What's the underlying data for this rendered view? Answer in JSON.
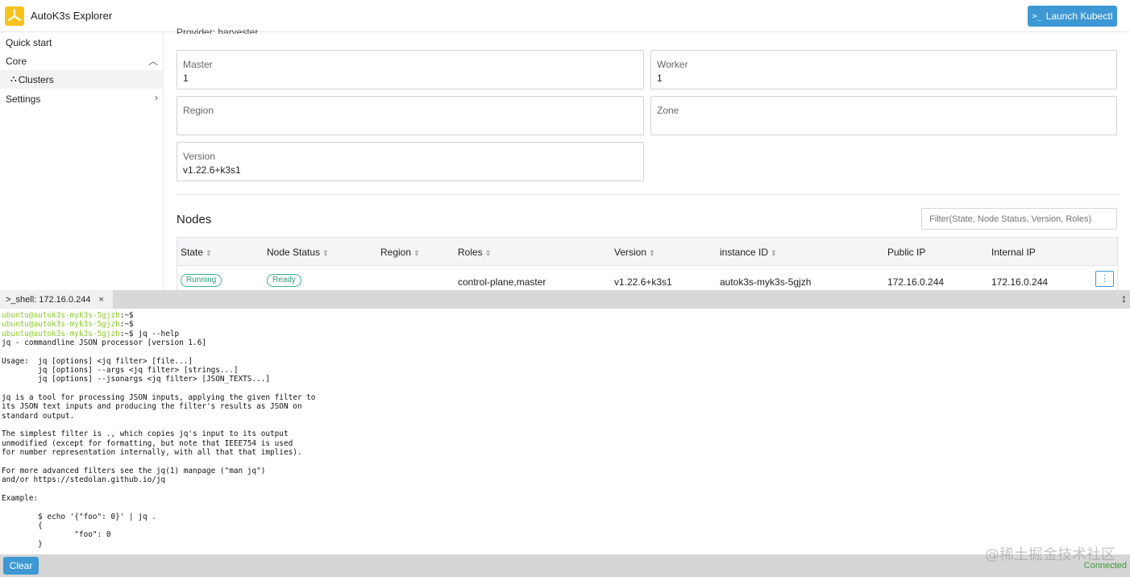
{
  "header": {
    "app_title": "AutoK3s Explorer",
    "launch_label": "Launch Kubectl",
    "launch_prompt": ">_"
  },
  "sidebar": {
    "items": [
      {
        "label": "Quick start"
      },
      {
        "label": "Core",
        "chevron": "^"
      },
      {
        "label": "Clusters",
        "icon": "cluster-icon"
      },
      {
        "label": "Settings",
        "chevron": ">"
      }
    ]
  },
  "detail": {
    "provider_partial": "Provider: harvester",
    "fields": {
      "master": {
        "label": "Master",
        "value": "1"
      },
      "worker": {
        "label": "Worker",
        "value": "1"
      },
      "region": {
        "label": "Region",
        "value": ""
      },
      "zone": {
        "label": "Zone",
        "value": ""
      },
      "version": {
        "label": "Version",
        "value": "v1.22.6+k3s1"
      }
    }
  },
  "nodes": {
    "title": "Nodes",
    "filter_placeholder": "Filter(State, Node Status, Version, Roles)",
    "columns": [
      "State",
      "Node Status",
      "Region",
      "Roles",
      "Version",
      "instance ID",
      "Public IP",
      "Internal IP"
    ],
    "sort_glyph": "⇕",
    "rows": [
      {
        "state": "Running",
        "node_status": "Ready",
        "region": "",
        "roles": "control-plane,master",
        "version": "v1.22.6+k3s1",
        "instance_id": "autok3s-myk3s-5gjzh",
        "public_ip": "172.16.0.244",
        "internal_ip": "172.16.0.244",
        "actions": "⋮"
      }
    ]
  },
  "terminal": {
    "tab_label": ">_shell: 172.16.0.244",
    "tab_close": "×",
    "resize": "↕",
    "prompt_user": "ubuntu@autok3s-myk3s-5gjzh",
    "prompt_suffix": ":~$",
    "command": " jq --help",
    "output": "jq - commandline JSON processor [version 1.6]\n\nUsage:  jq [options] <jq filter> [file...]\n        jq [options] --args <jq filter> [strings...]\n        jq [options] --jsonargs <jq filter> [JSON_TEXTS...]\n\njq is a tool for processing JSON inputs, applying the given filter to\nits JSON text inputs and producing the filter's results as JSON on\nstandard output.\n\nThe simplest filter is ., which copies jq's input to its output\nunmodified (except for formatting, but note that IEEE754 is used\nfor number representation internally, with all that that implies).\n\nFor more advanced filters see the jq(1) manpage (\"man jq\")\nand/or https://stedolan.github.io/jq\n\nExample:\n\n        $ echo '{\"foo\": 0}' | jq .\n        {\n                \"foo\": 0\n        }",
    "clear_label": "Clear",
    "status": "Connected"
  },
  "watermark": "@稀土掘金技术社区",
  "colors": {
    "accent": "#3d98d3",
    "status_green": "#3ab58a",
    "prompt_green": "#8ac924",
    "logo_yellow": "#f7c21c"
  }
}
